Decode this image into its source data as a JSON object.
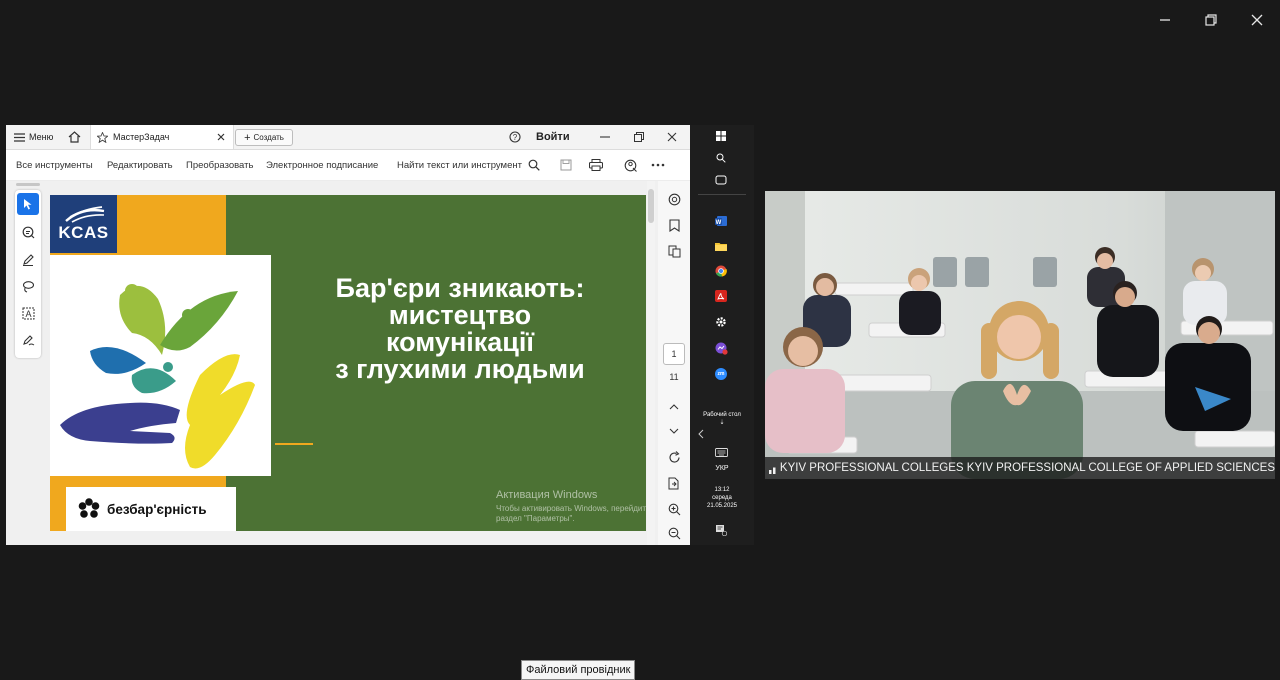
{
  "acrobat": {
    "menu_label": "Меню",
    "tab_title": "МастерЗадач",
    "create_label": "Создать",
    "signin_label": "Войти",
    "toolbar": {
      "all_tools": "Все инструменты",
      "edit": "Редактировать",
      "convert": "Преобразовать",
      "esign": "Электронное подписание",
      "find": "Найти текст или инструмент"
    },
    "page_current": "1",
    "page_total": "11"
  },
  "slide": {
    "logo_text": "KCAS",
    "title_lines": [
      "Бар'єри зникають:",
      "мистецтво",
      "комунікації",
      "з глухими людьми"
    ],
    "badge_text": "безбар'єрність",
    "colors": {
      "green": "#4c7234",
      "orange": "#f0a81e",
      "navy": "#1f3f7a"
    }
  },
  "activation": {
    "title": "Активация Windows",
    "line1": "Чтобы активировать Windows, перейдите в",
    "line2": "раздел \"Параметры\"."
  },
  "taskbar": {
    "desktop_label": "Рабочий стол",
    "desktop_arrow": "⇣",
    "lang": "УКР",
    "time": "13:12",
    "weekday": "середа",
    "date": "21.05.2025",
    "notif_count": "1",
    "zoom_label": "zm"
  },
  "video": {
    "caption": "KYIV PROFESSIONAL COLLEGES KYIV PROFESSIONAL COLLEGE OF APPLIED SCIENCES"
  },
  "tooltip": "Файловий провідник"
}
